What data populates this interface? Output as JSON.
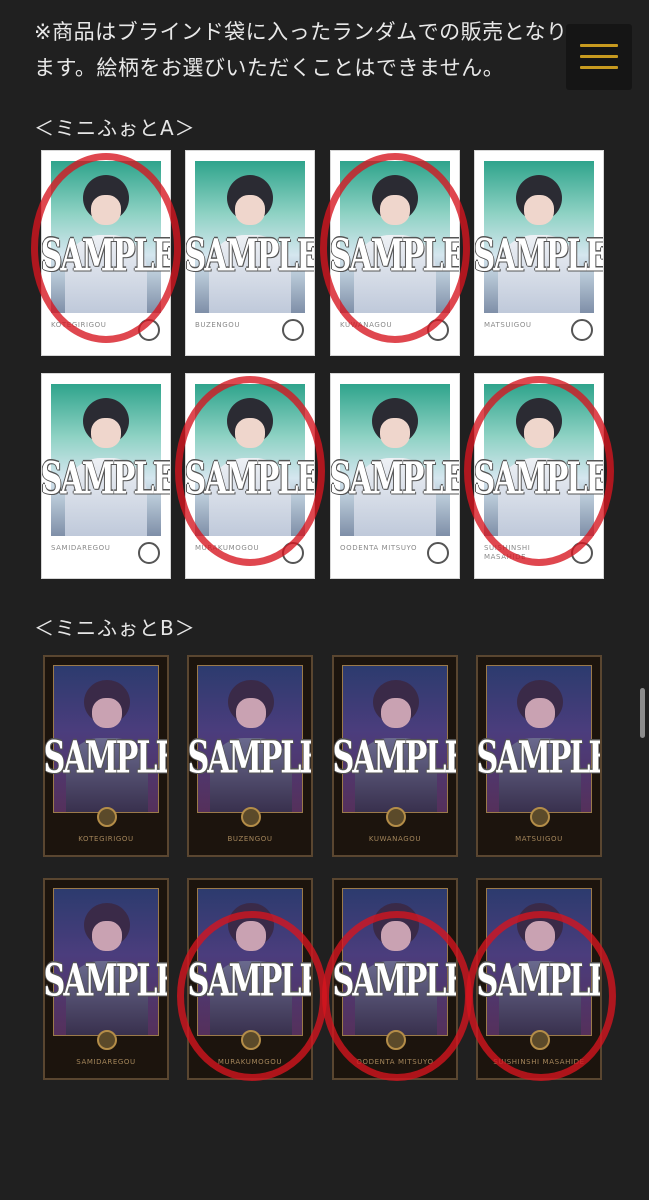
{
  "notice": {
    "line1": "※商品はブラインド袋に入ったランダムでの販売となり",
    "line2": "ます。絵柄をお選びいただくことはできません。"
  },
  "menu": {
    "icon": "hamburger-menu-icon",
    "color": "#c79a1f"
  },
  "section_a": {
    "title": "＜ミニふぉとA＞",
    "watermark": "SAMPLE",
    "cards": [
      {
        "name": "KOTEGIRIGOU",
        "circled": true
      },
      {
        "name": "BUZENGOU",
        "circled": false
      },
      {
        "name": "KUWANAGOU",
        "circled": true
      },
      {
        "name": "MATSUIGOU",
        "circled": false
      },
      {
        "name": "SAMIDAREGOU",
        "circled": false
      },
      {
        "name": "MURAKUMOGOU",
        "circled": true
      },
      {
        "name": "OODENTA MITSUYO",
        "circled": false
      },
      {
        "name": "SUISHINSHI MASAHIDE",
        "circled": true
      }
    ]
  },
  "section_b": {
    "title": "＜ミニふぉとB＞",
    "watermark": "SAMPLE",
    "cards": [
      {
        "name": "KOTEGIRIGOU",
        "circled": false
      },
      {
        "name": "BUZENGOU",
        "circled": false
      },
      {
        "name": "KUWANAGOU",
        "circled": false
      },
      {
        "name": "MATSUIGOU",
        "circled": false
      },
      {
        "name": "SAMIDAREGOU",
        "circled": false
      },
      {
        "name": "MURAKUMOGOU",
        "circled": true
      },
      {
        "name": "OODENTA MITSUYO",
        "circled": true
      },
      {
        "name": "SUISHINSHI MASAHIDE",
        "circled": true
      }
    ]
  },
  "colors": {
    "background": "#202020",
    "circle_mark": "#d6141e",
    "gold": "#c79a1f"
  }
}
